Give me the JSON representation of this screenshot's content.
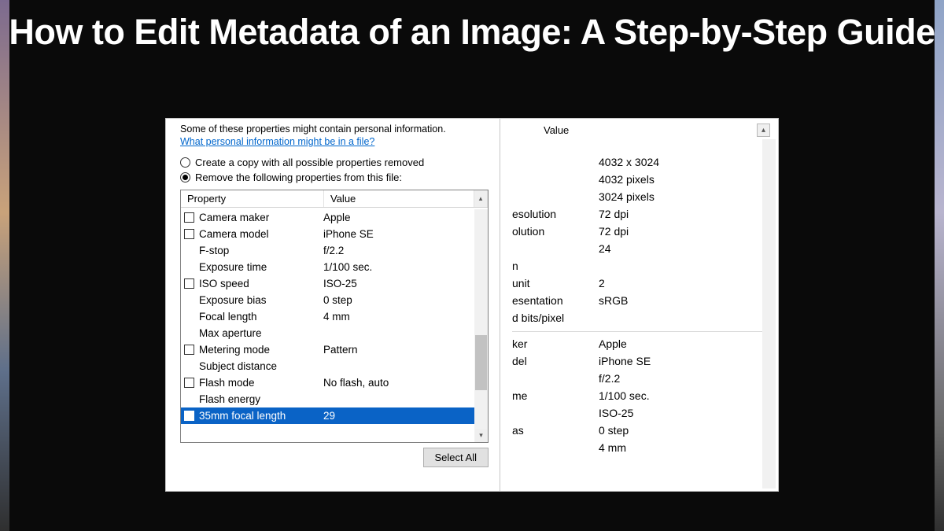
{
  "headline": "How to Edit Metadata of an Image: A Step-by-Step Guide",
  "remove_pane": {
    "privacy_note": "Some of these properties might contain personal information.",
    "privacy_link": "What personal information might be in a file?",
    "radio_copy": "Create a copy with all possible properties removed",
    "radio_remove": "Remove the following properties from this file:",
    "header_property": "Property",
    "header_value": "Value",
    "select_all": "Select All",
    "rows": [
      {
        "cb": true,
        "label": "Camera maker",
        "value": "Apple"
      },
      {
        "cb": true,
        "label": "Camera model",
        "value": "iPhone SE"
      },
      {
        "cb": false,
        "label": "F-stop",
        "value": "f/2.2"
      },
      {
        "cb": false,
        "label": "Exposure time",
        "value": "1/100 sec."
      },
      {
        "cb": true,
        "label": "ISO speed",
        "value": "ISO-25"
      },
      {
        "cb": false,
        "label": "Exposure bias",
        "value": "0 step"
      },
      {
        "cb": false,
        "label": "Focal length",
        "value": "4 mm"
      },
      {
        "cb": false,
        "label": "Max aperture",
        "value": ""
      },
      {
        "cb": true,
        "label": "Metering mode",
        "value": "Pattern"
      },
      {
        "cb": false,
        "label": "Subject distance",
        "value": ""
      },
      {
        "cb": true,
        "label": "Flash mode",
        "value": "No flash, auto"
      },
      {
        "cb": false,
        "label": "Flash energy",
        "value": ""
      },
      {
        "cb": true,
        "label": "35mm focal length",
        "value": "29",
        "selected": true
      }
    ]
  },
  "details_pane": {
    "header_value": "Value",
    "top_rows": [
      {
        "label": "",
        "value": "4032 x 3024"
      },
      {
        "label": "",
        "value": "4032 pixels"
      },
      {
        "label": "",
        "value": "3024 pixels"
      },
      {
        "label": "esolution",
        "value": "72 dpi"
      },
      {
        "label": "olution",
        "value": "72 dpi"
      },
      {
        "label": "",
        "value": "24"
      },
      {
        "label": "n",
        "value": ""
      },
      {
        "label": "unit",
        "value": "2"
      },
      {
        "label": "esentation",
        "value": "sRGB"
      },
      {
        "label": "d bits/pixel",
        "value": ""
      }
    ],
    "bottom_rows": [
      {
        "label": "ker",
        "value": "Apple"
      },
      {
        "label": "del",
        "value": "iPhone SE"
      },
      {
        "label": "",
        "value": "f/2.2"
      },
      {
        "label": "me",
        "value": "1/100 sec."
      },
      {
        "label": "",
        "value": "ISO-25"
      },
      {
        "label": "as",
        "value": "0 step"
      },
      {
        "label": "",
        "value": "4 mm"
      }
    ]
  }
}
